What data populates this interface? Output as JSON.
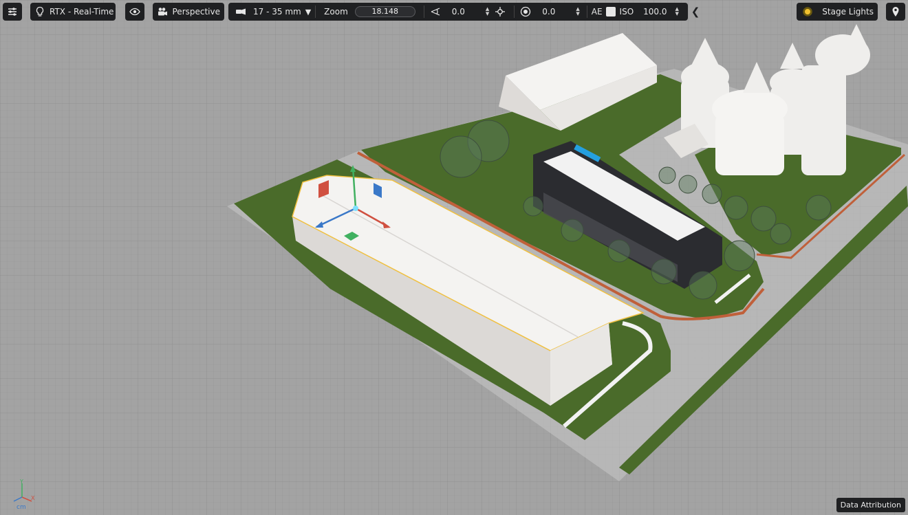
{
  "toolbar": {
    "render_mode": "RTX - Real-Time",
    "camera": "Perspective",
    "lens": "17 - 35 mm",
    "zoom_label": "Zoom",
    "zoom_value": "18.148",
    "tilt_value": "0.0",
    "aperture_value": "0.0",
    "ae_label": "AE",
    "iso_label": "ISO",
    "iso_value": "100.0",
    "lights": "Stage Lights"
  },
  "status": {
    "data_attribution": "Data Attribution",
    "unit": "cm"
  },
  "gizmo_axes": {
    "x": "X",
    "y": "Y"
  },
  "colors": {
    "toolbar_bg": "#1f2022",
    "ground": "#9a9a9a",
    "grass": "#4a6b2a",
    "building": "#eeecea",
    "selection": "#f0c040",
    "axis_x": "#d05040",
    "axis_y": "#40b060",
    "axis_z": "#3a78c8"
  },
  "icons": [
    "settings-sliders-icon",
    "lightbulb-icon",
    "eye-icon",
    "camera-icon",
    "lens-icon",
    "tilt-icon",
    "move-icon",
    "aperture-icon",
    "collapse-icon",
    "sun-icon",
    "location-pin-icon"
  ]
}
